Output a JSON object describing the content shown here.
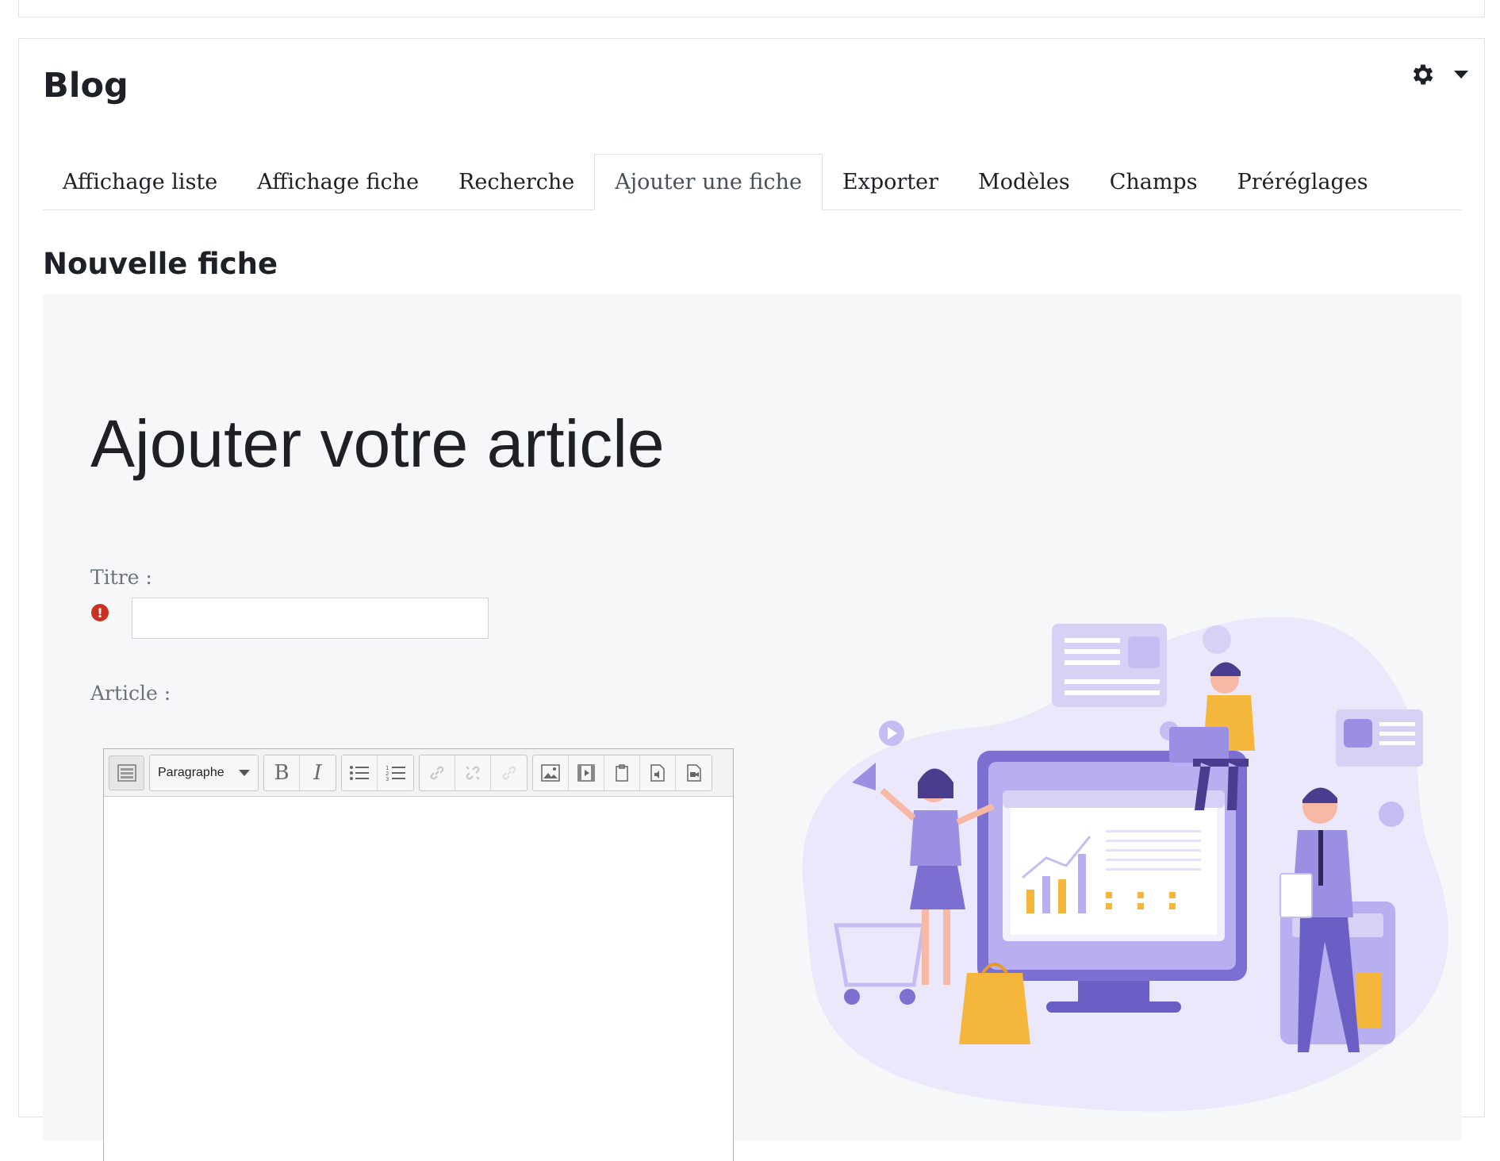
{
  "block": {
    "title": "Blog"
  },
  "tabs": [
    {
      "label": "Affichage liste",
      "active": false
    },
    {
      "label": "Affichage fiche",
      "active": false
    },
    {
      "label": "Recherche",
      "active": false
    },
    {
      "label": "Ajouter une fiche",
      "active": true
    },
    {
      "label": "Exporter",
      "active": false
    },
    {
      "label": "Modèles",
      "active": false
    },
    {
      "label": "Champs",
      "active": false
    },
    {
      "label": "Préréglages",
      "active": false
    }
  ],
  "section_title": "Nouvelle fiche",
  "form": {
    "heading": "Ajouter votre article",
    "title_label": "Titre :",
    "title_value": "",
    "title_required_icon": "!",
    "article_label": "Article :",
    "editor": {
      "paragraph_select": "Paragraphe",
      "bold": "B",
      "italic": "I",
      "article_value": ""
    }
  },
  "colors": {
    "accent_purple": "#7b6fd1",
    "light_purple": "#ebe8fb",
    "required_red": "#ca3120",
    "panel_bg": "#f6f7f9"
  },
  "icons": [
    "gear-icon",
    "chevron-down-icon",
    "required-icon",
    "toolbar-toggle-icon",
    "unordered-list-icon",
    "ordered-list-icon",
    "link-icon",
    "unlink-icon",
    "anchor-icon",
    "image-icon",
    "media-icon",
    "manage-files-icon",
    "record-audio-icon",
    "record-video-icon"
  ]
}
